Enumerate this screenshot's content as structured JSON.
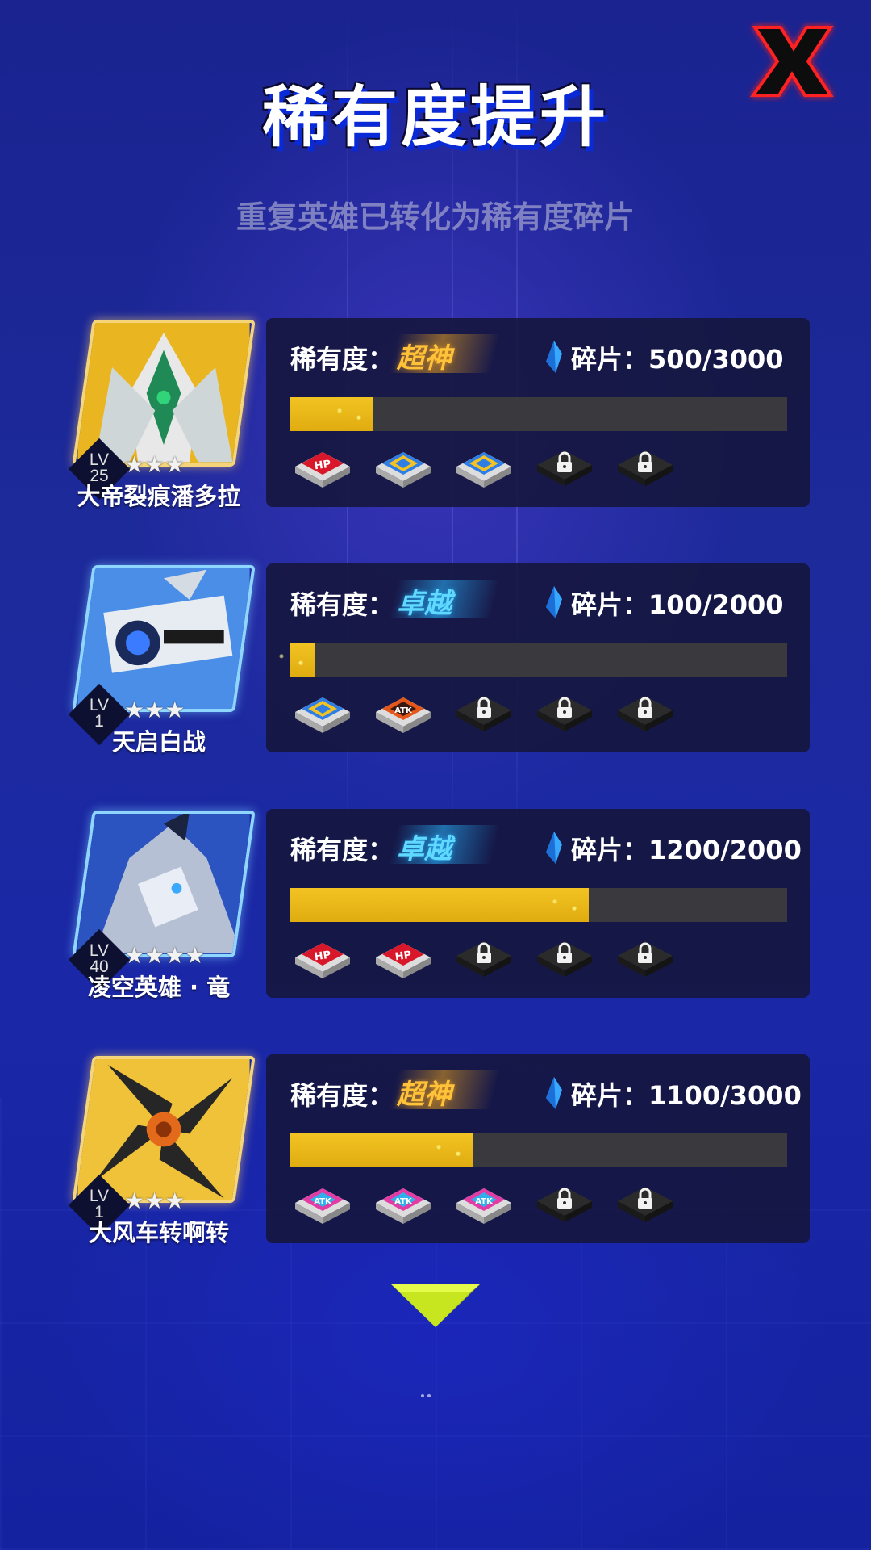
{
  "header": {
    "title": "稀有度提升",
    "subtitle": "重复英雄已转化为稀有度碎片"
  },
  "colors": {
    "accent_gold": "#f2c322",
    "rarity_gold": "#ffc238",
    "rarity_cyan": "#5fd9ff",
    "close_red": "#ff2020",
    "arrow_green": "#c8e620"
  },
  "heroes": [
    {
      "name": "大帝裂痕潘多拉",
      "lv_label": "LV",
      "level": "25",
      "stars": "★★★",
      "star_count": 3,
      "frame": "gold",
      "rarity_label": "稀有度：",
      "rarity": "超神",
      "rarity_color": "gold",
      "shard_label": "碎片：",
      "shards": "500/3000",
      "progress": 0.167,
      "slots": [
        "hp-badge-icon",
        "fire-blue-badge-icon",
        "fire-blue-badge-icon",
        "lock-icon",
        "lock-icon"
      ]
    },
    {
      "name": "天启白战",
      "lv_label": "LV",
      "level": "1",
      "stars": "★★★",
      "star_count": 3,
      "frame": "blue",
      "rarity_label": "稀有度：",
      "rarity": "卓越",
      "rarity_color": "cyan",
      "shard_label": "碎片：",
      "shards": "100/2000",
      "progress": 0.05,
      "slots": [
        "fire-blue-badge-icon",
        "atk-orange-badge-icon",
        "lock-icon",
        "lock-icon",
        "lock-icon"
      ]
    },
    {
      "name": "凌空英雄 · 竜",
      "lv_label": "LV",
      "level": "40",
      "stars": "★★★★",
      "star_count": 4,
      "frame": "blue",
      "rarity_label": "稀有度：",
      "rarity": "卓越",
      "rarity_color": "cyan",
      "shard_label": "碎片：",
      "shards": "1200/2000",
      "progress": 0.6,
      "slots": [
        "hp-badge-icon",
        "hp-badge-icon",
        "lock-icon",
        "lock-icon",
        "lock-icon"
      ]
    },
    {
      "name": "大风车转啊转",
      "lv_label": "LV",
      "level": "1",
      "stars": "★★★",
      "star_count": 3,
      "frame": "gold",
      "rarity_label": "稀有度：",
      "rarity": "超神",
      "rarity_color": "gold",
      "shard_label": "碎片：",
      "shards": "1100/3000",
      "progress": 0.367,
      "slots": [
        "atk-pink-badge-icon",
        "atk-pink-badge-icon",
        "atk-pink-badge-icon",
        "lock-icon",
        "lock-icon"
      ]
    }
  ]
}
